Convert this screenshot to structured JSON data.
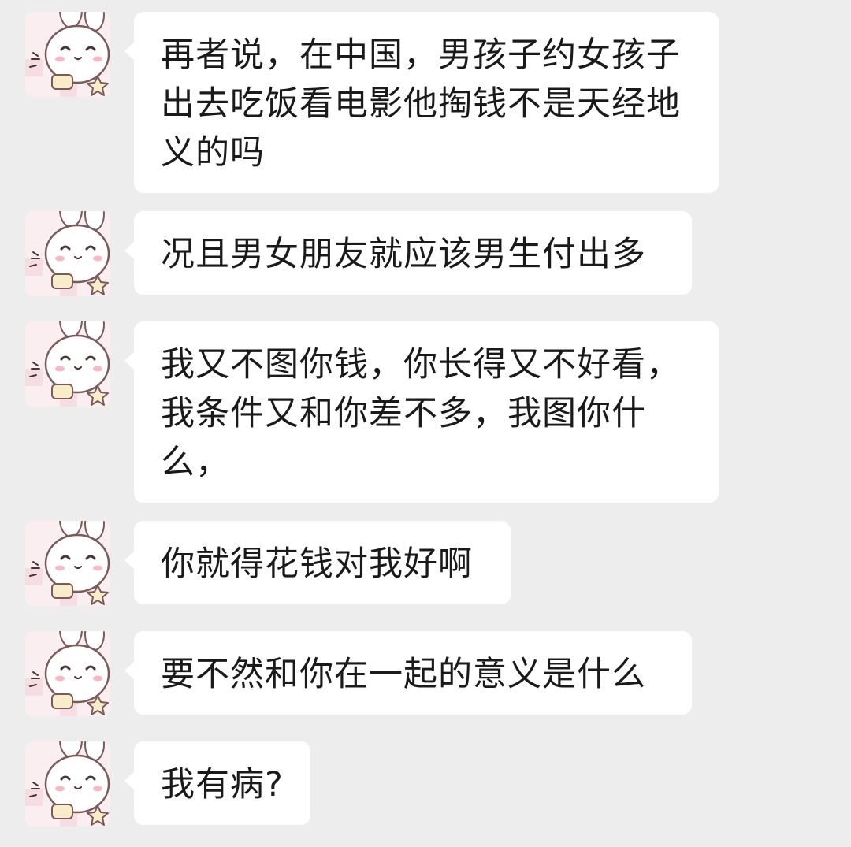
{
  "chat": {
    "messages": [
      {
        "sender": "other",
        "avatar": "cartoon-bunny-avatar",
        "text": "再者说，在中国，男孩子约女孩子出去吃饭看电影他掏钱不是天经地义的吗"
      },
      {
        "sender": "other",
        "avatar": "cartoon-bunny-avatar",
        "text": "况且男女朋友就应该男生付出多"
      },
      {
        "sender": "other",
        "avatar": "cartoon-bunny-avatar",
        "text": "我又不图你钱，你长得又不好看，我条件又和你差不多，我图你什么，"
      },
      {
        "sender": "other",
        "avatar": "cartoon-bunny-avatar",
        "text": "你就得花钱对我好啊"
      },
      {
        "sender": "other",
        "avatar": "cartoon-bunny-avatar",
        "text": "要不然和你在一起的意义是什么"
      },
      {
        "sender": "other",
        "avatar": "cartoon-bunny-avatar",
        "text": "我有病?"
      }
    ]
  },
  "colors": {
    "background": "#ededed",
    "bubble": "#ffffff",
    "text": "#1a1a1a",
    "avatar_bg": "#fbeef1"
  }
}
